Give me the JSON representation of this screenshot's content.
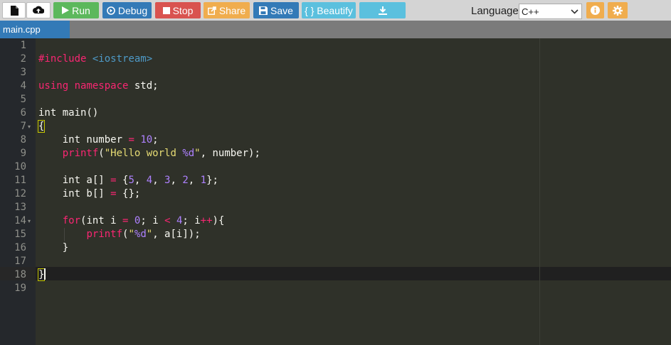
{
  "toolbar": {
    "run_label": "Run",
    "debug_label": "Debug",
    "stop_label": "Stop",
    "share_label": "Share",
    "save_label": "Save",
    "beautify_label": "{ } Beautify",
    "language_label": "Language",
    "language_value": "C++"
  },
  "tab": {
    "file_name": "main.cpp"
  },
  "editor": {
    "line_numbers": [
      "1",
      "2",
      "3",
      "4",
      "5",
      "6",
      "7",
      "8",
      "9",
      "10",
      "11",
      "12",
      "13",
      "14",
      "15",
      "16",
      "17",
      "18",
      "19"
    ],
    "code": {
      "l2_pre": "#include",
      "l2_inc": " <iostream>",
      "l4_a": "using",
      "l4_b": " ",
      "l4_c": "namespace",
      "l4_d": " std;",
      "l6": "int main()",
      "l7": "{",
      "l8_a": "    int number ",
      "l8_b": "=",
      "l8_c": " ",
      "l8_d": "10",
      "l8_e": ";",
      "l9_a": "    ",
      "l9_b": "printf",
      "l9_c": "(",
      "l9_d": "\"Hello world ",
      "l9_e": "%d",
      "l9_f": "\"",
      "l9_g": ", number);",
      "l11_a": "    int a[] ",
      "l11_b": "=",
      "l11_c": " {",
      "l11_d": "5",
      "l11_e": ", ",
      "l11_f": "4",
      "l11_g": ", ",
      "l11_h": "3",
      "l11_i": ", ",
      "l11_j": "2",
      "l11_k": ", ",
      "l11_l": "1",
      "l11_m": "};",
      "l12_a": "    int b[] ",
      "l12_b": "=",
      "l12_c": " {};",
      "l14_a": "    ",
      "l14_b": "for",
      "l14_c": "(int i ",
      "l14_d": "=",
      "l14_e": " ",
      "l14_f": "0",
      "l14_g": "; i ",
      "l14_h": "<",
      "l14_i": " ",
      "l14_j": "4",
      "l14_k": "; i",
      "l14_l": "++",
      "l14_m": "){",
      "l15_a": "        ",
      "l15_b": "printf",
      "l15_c": "(",
      "l15_d": "\"",
      "l15_e": "%d",
      "l15_f": "\"",
      "l15_g": ", a[i]);",
      "l16": "    }",
      "l18": "}"
    }
  },
  "colors": {
    "run": "#5cb85c",
    "debug": "#337ab7",
    "stop": "#d9534f",
    "share": "#f0ad4e",
    "save": "#337ab7",
    "beautify": "#5bc0de",
    "editor_bg": "#2f3129",
    "gutter_bg": "#25282c"
  },
  "icons": {
    "new": "file-icon",
    "upload": "cloud-upload-icon",
    "run": "play-icon",
    "debug": "debug-icon",
    "stop": "stop-icon",
    "share": "share-icon",
    "save": "save-icon",
    "download": "download-icon",
    "info": "info-icon",
    "settings": "gear-icon",
    "select": "chevron-down-icon"
  }
}
